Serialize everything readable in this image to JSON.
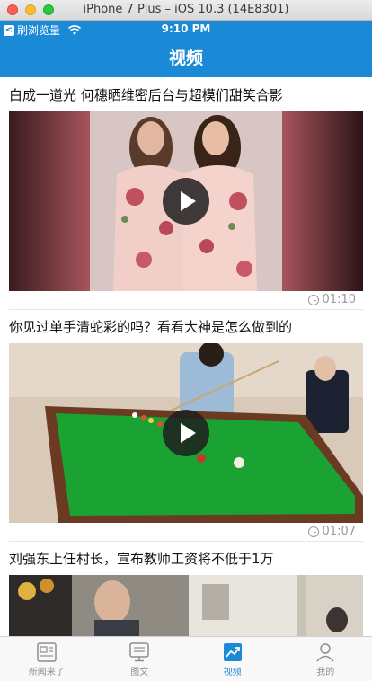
{
  "window": {
    "title": "iPhone 7 Plus – iOS 10.3 (14E8301)"
  },
  "status_bar": {
    "back_app": "刷浏览量",
    "time": "9:10 PM"
  },
  "nav": {
    "title": "视频"
  },
  "feed": {
    "items": [
      {
        "title": "白成一道光 何穗晒维密后台与超模们甜笑合影",
        "duration": "01:10",
        "thumb_icon": "fashion-models-photo"
      },
      {
        "title": "你见过单手清蛇彩的吗？看看大神是怎么做到的",
        "duration": "01:07",
        "thumb_icon": "billiards-table-photo"
      },
      {
        "title": "刘强东上任村长，宣布教师工资将不低于1万",
        "duration": "",
        "thumb_icon": "village-street-photo"
      }
    ]
  },
  "tabs": [
    {
      "label": "新闻来了",
      "icon": "news-icon",
      "active": false
    },
    {
      "label": "图文",
      "icon": "image-text-icon",
      "active": false
    },
    {
      "label": "视频",
      "icon": "video-chart-icon",
      "active": true
    },
    {
      "label": "我的",
      "icon": "profile-icon",
      "active": false
    }
  ],
  "colors": {
    "accent": "#1a8ad6",
    "tab_inactive": "#8e8e8e"
  }
}
